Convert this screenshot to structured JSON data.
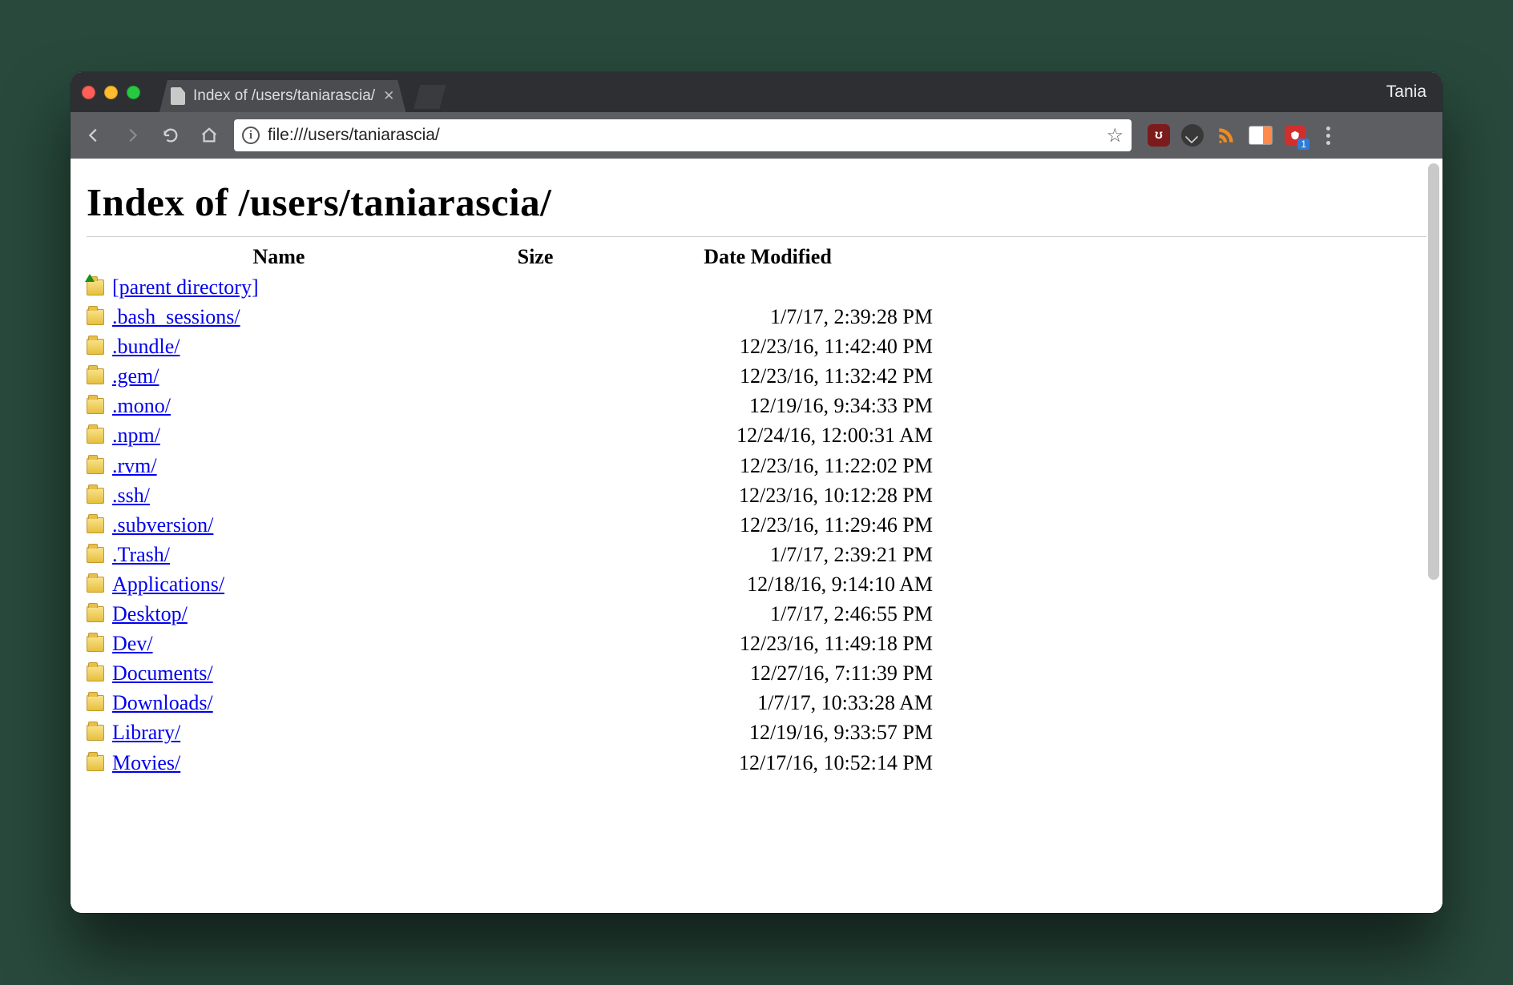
{
  "browser": {
    "profile_name": "Tania",
    "tab_title": "Index of /users/taniarascia/",
    "url": "file:///users/taniarascia/",
    "lastpass_badge": "1"
  },
  "page": {
    "heading": "Index of /users/taniarascia/",
    "columns": {
      "name": "Name",
      "size": "Size",
      "date": "Date Modified"
    },
    "parent_label": "[parent directory]",
    "entries": [
      {
        "name": ".bash_sessions/",
        "size": "",
        "date": "1/7/17, 2:39:28 PM"
      },
      {
        "name": ".bundle/",
        "size": "",
        "date": "12/23/16, 11:42:40 PM"
      },
      {
        "name": ".gem/",
        "size": "",
        "date": "12/23/16, 11:32:42 PM"
      },
      {
        "name": ".mono/",
        "size": "",
        "date": "12/19/16, 9:34:33 PM"
      },
      {
        "name": ".npm/",
        "size": "",
        "date": "12/24/16, 12:00:31 AM"
      },
      {
        "name": ".rvm/",
        "size": "",
        "date": "12/23/16, 11:22:02 PM"
      },
      {
        "name": ".ssh/",
        "size": "",
        "date": "12/23/16, 10:12:28 PM"
      },
      {
        "name": ".subversion/",
        "size": "",
        "date": "12/23/16, 11:29:46 PM"
      },
      {
        "name": ".Trash/",
        "size": "",
        "date": "1/7/17, 2:39:21 PM"
      },
      {
        "name": "Applications/",
        "size": "",
        "date": "12/18/16, 9:14:10 AM"
      },
      {
        "name": "Desktop/",
        "size": "",
        "date": "1/7/17, 2:46:55 PM"
      },
      {
        "name": "Dev/",
        "size": "",
        "date": "12/23/16, 11:49:18 PM"
      },
      {
        "name": "Documents/",
        "size": "",
        "date": "12/27/16, 7:11:39 PM"
      },
      {
        "name": "Downloads/",
        "size": "",
        "date": "1/7/17, 10:33:28 AM"
      },
      {
        "name": "Library/",
        "size": "",
        "date": "12/19/16, 9:33:57 PM"
      },
      {
        "name": "Movies/",
        "size": "",
        "date": "12/17/16, 10:52:14 PM"
      }
    ]
  }
}
